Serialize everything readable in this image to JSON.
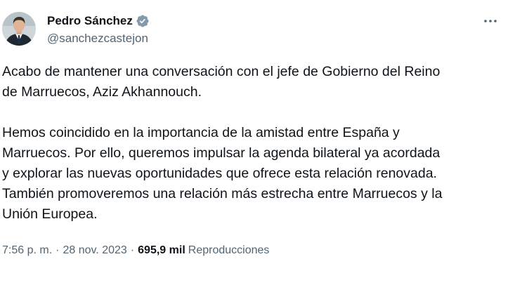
{
  "author": {
    "display_name": "Pedro Sánchez",
    "handle": "@sanchezcastejon",
    "verified": true,
    "avatar_icon": "profile-photo",
    "verified_color": "#829aab"
  },
  "menu": {
    "more_icon": "ellipsis-icon"
  },
  "tweet": {
    "paragraph_1": "Acabo de mantener una conversación con el jefe de Gobierno del Reino\nde Marruecos, Aziz Akhannouch.",
    "paragraph_2": "Hemos coincidido en la importancia de la amistad entre España y\nMarruecos. Por ello, queremos impulsar la agenda bilateral ya acordada\ny explorar las nuevas oportunidades que ofrece esta relación renovada.\nTambién promoveremos una relación más estrecha entre Marruecos y la\nUnión Europea."
  },
  "meta": {
    "time": "7:56 p. m.",
    "separator": "·",
    "date": "28 nov. 2023",
    "views_count": "695,9 mil",
    "views_label": "Reproducciones"
  }
}
